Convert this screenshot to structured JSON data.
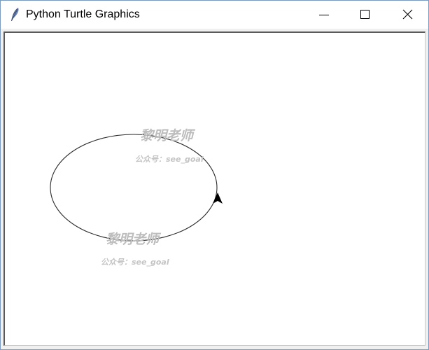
{
  "window": {
    "title": "Python Turtle Graphics",
    "app_icon": "feather-icon",
    "controls": {
      "minimize_icon": "minimize-icon",
      "maximize_icon": "maximize-icon",
      "close_icon": "close-icon"
    }
  },
  "canvas": {
    "background": "#ffffff",
    "pen_color": "#000000",
    "shape": "ellipse",
    "turtle_icon": "turtle-arrow-icon"
  },
  "watermarks": [
    {
      "main": "黎明老师",
      "sub": "公众号：see_goal"
    },
    {
      "main": "黎明老师",
      "sub": "公众号：see_goal"
    }
  ]
}
